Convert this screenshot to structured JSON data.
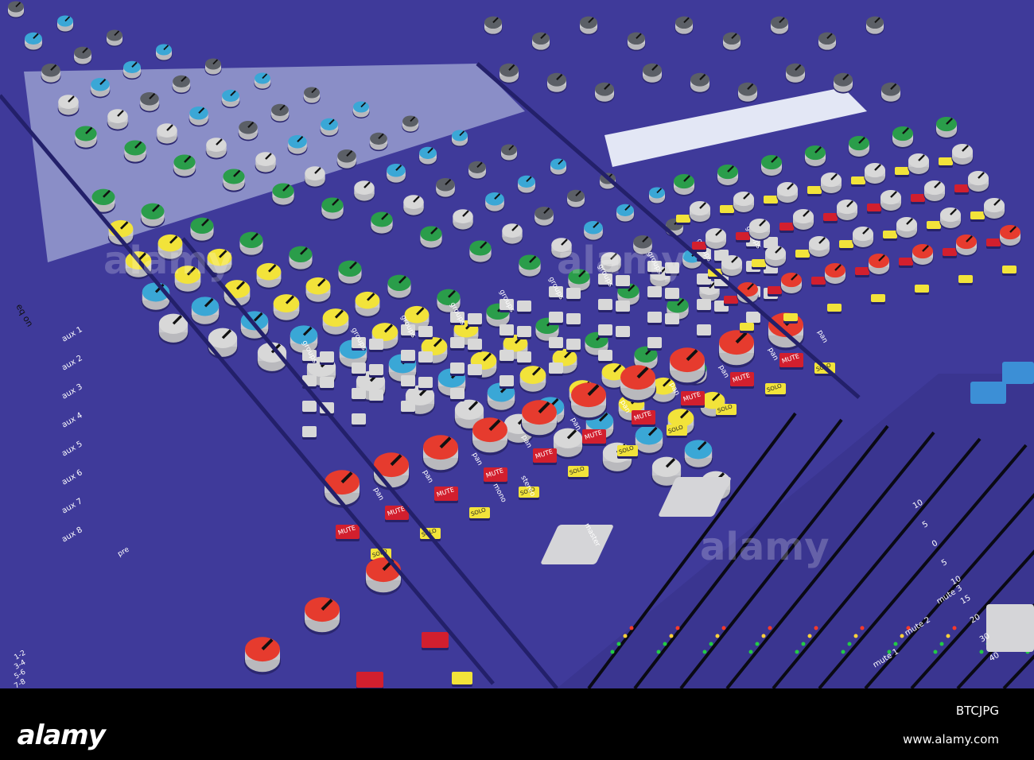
{
  "photo": {
    "subject": "audio mixing console",
    "panel_color": "#3f3a9a",
    "knob_cap_colors": [
      "#e63b2e",
      "#2a9d4a",
      "#f2e33a",
      "#3aa7d6",
      "#5b5f66",
      "#d8d8d8"
    ],
    "panel_labels": {
      "mute_label": "MUTE",
      "solo_label": "SOLO",
      "pan_label": "pan",
      "stereo_label": "stereo",
      "mono_label": "mono",
      "groups_label": "groups",
      "master_label": "master",
      "aux_labels": [
        "aux 1",
        "aux 2",
        "aux 3",
        "aux 4",
        "aux 5",
        "aux 6",
        "aux 7",
        "aux 8"
      ],
      "pre_label": "pre",
      "group_pairs": [
        "1-2",
        "3-4",
        "5-6",
        "7-8"
      ],
      "eq_on_label": "eq on",
      "fader_scale": [
        "10",
        "5",
        "0",
        "5",
        "10",
        "15",
        "20",
        "30",
        "40"
      ],
      "mute_group_labels": [
        "mute 1",
        "mute 2",
        "mute 3"
      ]
    }
  },
  "banner": {
    "logo_text": "alamy",
    "stock_id": "BTCJPG",
    "url": "www.alamy.com",
    "background": "#000000"
  },
  "watermark": {
    "text": "alamy"
  }
}
